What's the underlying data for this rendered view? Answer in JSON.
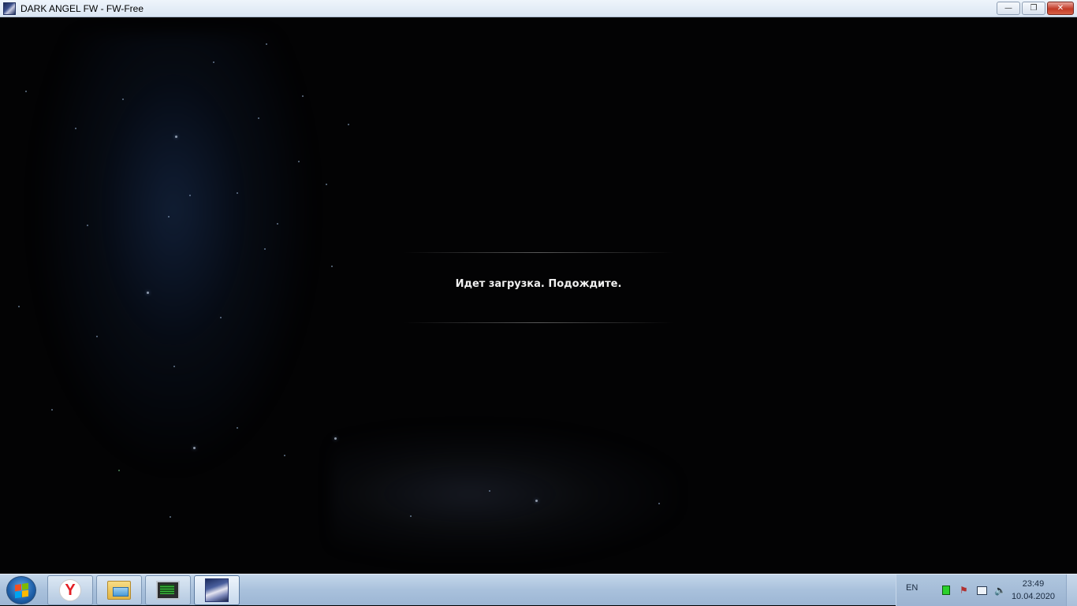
{
  "window": {
    "title": "DARK ANGEL FW - FW-Free",
    "icon": "dark-angel-app-icon",
    "buttons": {
      "minimize": "—",
      "restore": "❐",
      "close": "✕"
    }
  },
  "game": {
    "loading_text": "Идет загрузка. Подождите."
  },
  "taskbar": {
    "start_icon": "windows-start-icon",
    "pinned": [
      {
        "name": "yandex-browser-icon",
        "glyph": "Y"
      },
      {
        "name": "file-explorer-icon"
      },
      {
        "name": "system-monitor-icon"
      },
      {
        "name": "dark-angel-game-icon",
        "active": true
      }
    ],
    "tray": {
      "language": "EN",
      "time": "23:49",
      "date": "10.04.2020"
    }
  }
}
